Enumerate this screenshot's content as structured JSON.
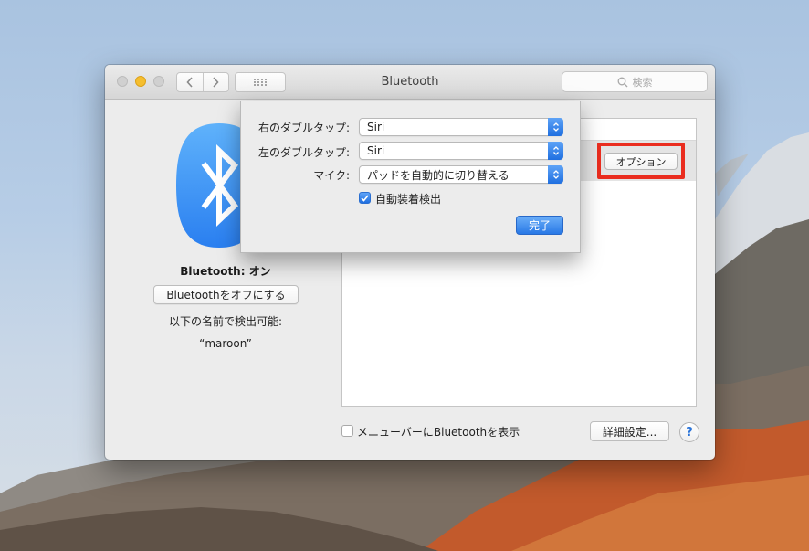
{
  "window": {
    "title": "Bluetooth",
    "search_placeholder": "検索"
  },
  "left_panel": {
    "status": "Bluetooth: オン",
    "toggle_label": "Bluetoothをオフにする",
    "discoverable_label": "以下の名前で検出可能:",
    "device_name": "“maroon”"
  },
  "device_list": {
    "options_button": "オプション"
  },
  "footer": {
    "menubar_checkbox_label": "メニューバーにBluetoothを表示",
    "menubar_checked": false,
    "advanced_button": "詳細設定...",
    "help_button": "?"
  },
  "sheet": {
    "right_double_tap_label": "右のダブルタップ:",
    "right_double_tap_value": "Siri",
    "left_double_tap_label": "左のダブルタップ:",
    "left_double_tap_value": "Siri",
    "mic_label": "マイク:",
    "mic_value": "パッドを自動的に切り替える",
    "auto_ear_detect_label": "自動装着検出",
    "auto_ear_detect_checked": true,
    "done_button": "完了"
  },
  "colors": {
    "accent": "#2a78e4",
    "highlight_border": "#ea2d1f",
    "traffic_min": "#f5be2f"
  }
}
